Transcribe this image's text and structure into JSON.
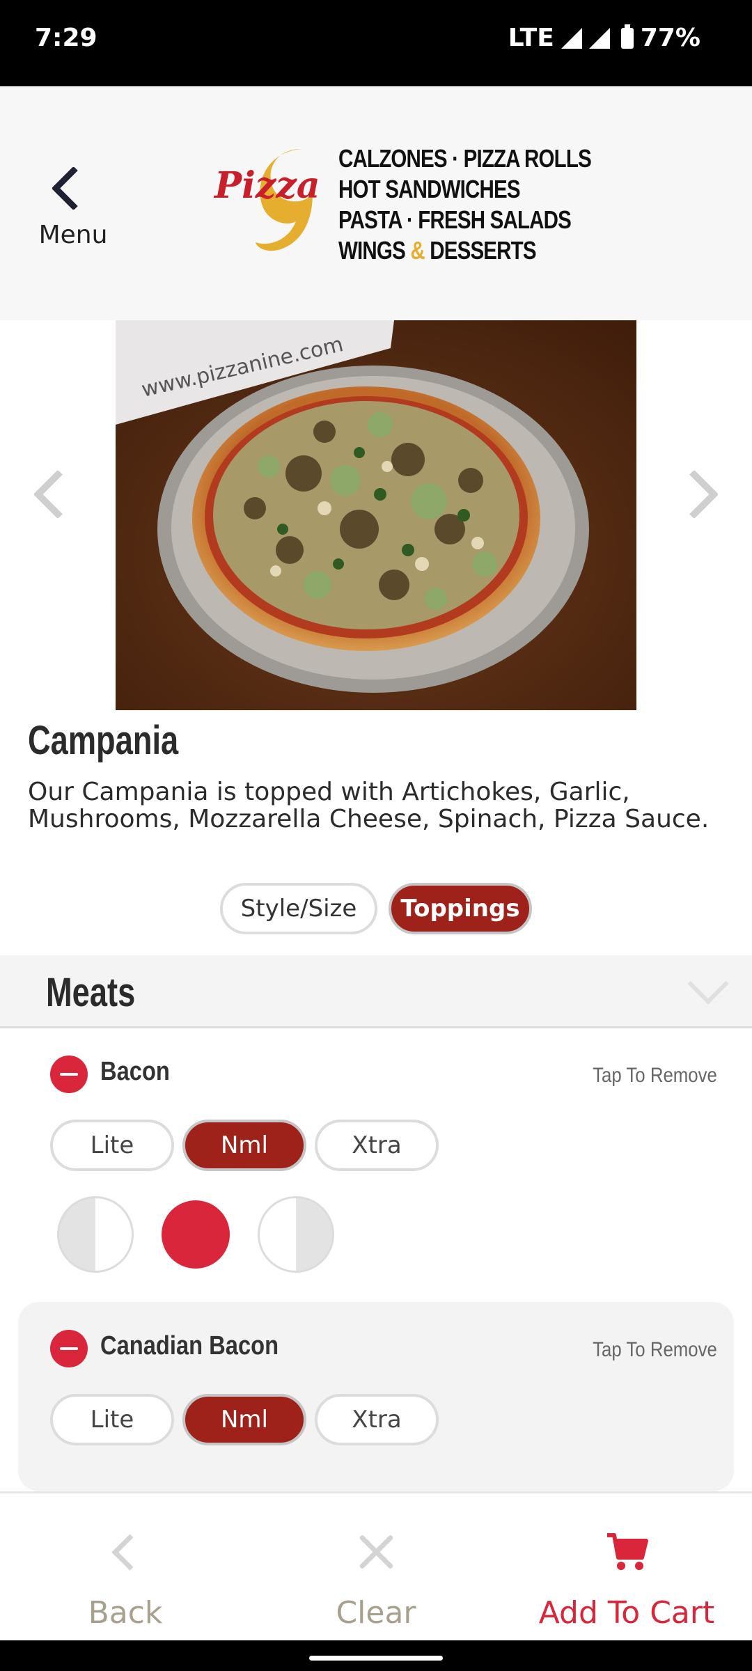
{
  "status": {
    "time": "7:29",
    "network": "LTE",
    "battery": "77%"
  },
  "header": {
    "back_label": "Menu",
    "logo": {
      "word": "Pizza",
      "numeral": "9",
      "lines": [
        "CALZONES · PIZZA ROLLS",
        "HOT SANDWICHES",
        "PASTA · FRESH SALADS"
      ],
      "last_line_a": "WINGS ",
      "last_line_amp": "&",
      "last_line_b": " DESSERTS"
    }
  },
  "product": {
    "image_text": "www.pizzanine.com",
    "title": "Campania",
    "description": "Our Campania is topped with Artichokes, Garlic, Mushrooms, Mozzarella Cheese, Spinach, Pizza Sauce."
  },
  "segments": {
    "style_size": "Style/Size",
    "toppings": "Toppings",
    "selected": "Toppings"
  },
  "section": {
    "title": "Meats"
  },
  "toppings": [
    {
      "name": "Bacon",
      "action": "Tap To Remove",
      "amounts": [
        "Lite",
        "Nml",
        "Xtra"
      ],
      "selected_amount": "Nml",
      "portion": "whole"
    },
    {
      "name": "Canadian Bacon",
      "action": "Tap To Remove",
      "amounts": [
        "Lite",
        "Nml",
        "Xtra"
      ],
      "selected_amount": "Nml",
      "portion": "whole"
    }
  ],
  "bottom_nav": {
    "back": "Back",
    "clear": "Clear",
    "add_to_cart": "Add To Cart"
  },
  "colors": {
    "accent": "#9e2219",
    "remove_red": "#d9263a",
    "cart_red": "#d9263a",
    "logo_gold": "#e6ae2e"
  }
}
